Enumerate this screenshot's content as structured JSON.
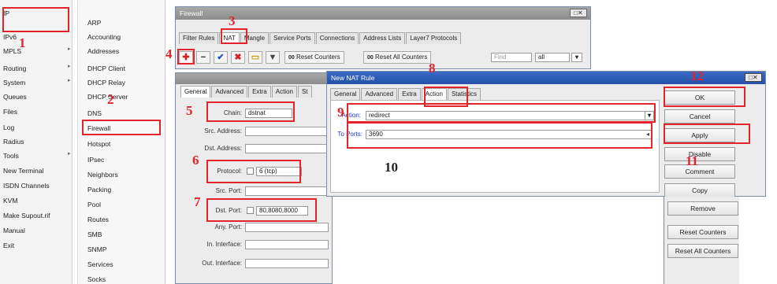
{
  "left_menu": [
    "IP",
    "IPv6",
    "MPLS",
    "Routing",
    "System",
    "Queues",
    "Files",
    "Log",
    "Radius",
    "Tools",
    "New Terminal",
    "ISDN Channels",
    "KVM",
    "Make Supout.rif",
    "Manual",
    "Exit"
  ],
  "sub_menu": [
    "ARP",
    "Accounting",
    "Addresses",
    "DHCP Client",
    "DHCP Relay",
    "DHCP Server",
    "DNS",
    "Firewall",
    "Hotspot",
    "IPsec",
    "Neighbors",
    "Packing",
    "Pool",
    "Routes",
    "SMB",
    "SNMP",
    "Services",
    "Socks"
  ],
  "firewall": {
    "title": "Firewall",
    "tabs": [
      "Filter Rules",
      "NAT",
      "Mangle",
      "Service Ports",
      "Connections",
      "Address Lists",
      "Layer7 Protocols"
    ],
    "reset_counters": "Reset Counters",
    "reset_all_counters": "Reset All Counters",
    "find_placeholder": "Find",
    "filter_value": "all"
  },
  "nat_rule_bg": {
    "tabs": [
      "General",
      "Advanced",
      "Extra",
      "Action",
      "St"
    ],
    "chain_label": "Chain:",
    "chain_value": "dstnat",
    "src_address_label": "Src. Address:",
    "dst_address_label": "Dst. Address:",
    "protocol_label": "Protocol:",
    "protocol_value": "6 (tcp)",
    "src_port_label": "Src. Port:",
    "dst_port_label": "Dst. Port:",
    "dst_port_value": "80,8080,8000",
    "any_port_label": "Any. Port:",
    "in_interface_label": "In. Interface:",
    "out_interface_label": "Out. Interface:"
  },
  "new_nat_rule": {
    "title": "New NAT Rule",
    "tabs": [
      "General",
      "Advanced",
      "Extra",
      "Action",
      "Statistics"
    ],
    "action_label": "Action:",
    "action_value": "redirect",
    "to_ports_label": "To Ports:",
    "to_ports_value": "3690"
  },
  "side_buttons": [
    "OK",
    "Cancel",
    "Apply",
    "Disable",
    "Comment",
    "Copy",
    "Remove",
    "Reset Counters",
    "Reset All Counters"
  ],
  "annotations": [
    "1",
    "2",
    "3",
    "4",
    "5",
    "6",
    "7",
    "8",
    "9",
    "10",
    "11",
    "12"
  ],
  "colors": {
    "annotation_red": "#e3242b",
    "title_blue": "#2450a8"
  }
}
